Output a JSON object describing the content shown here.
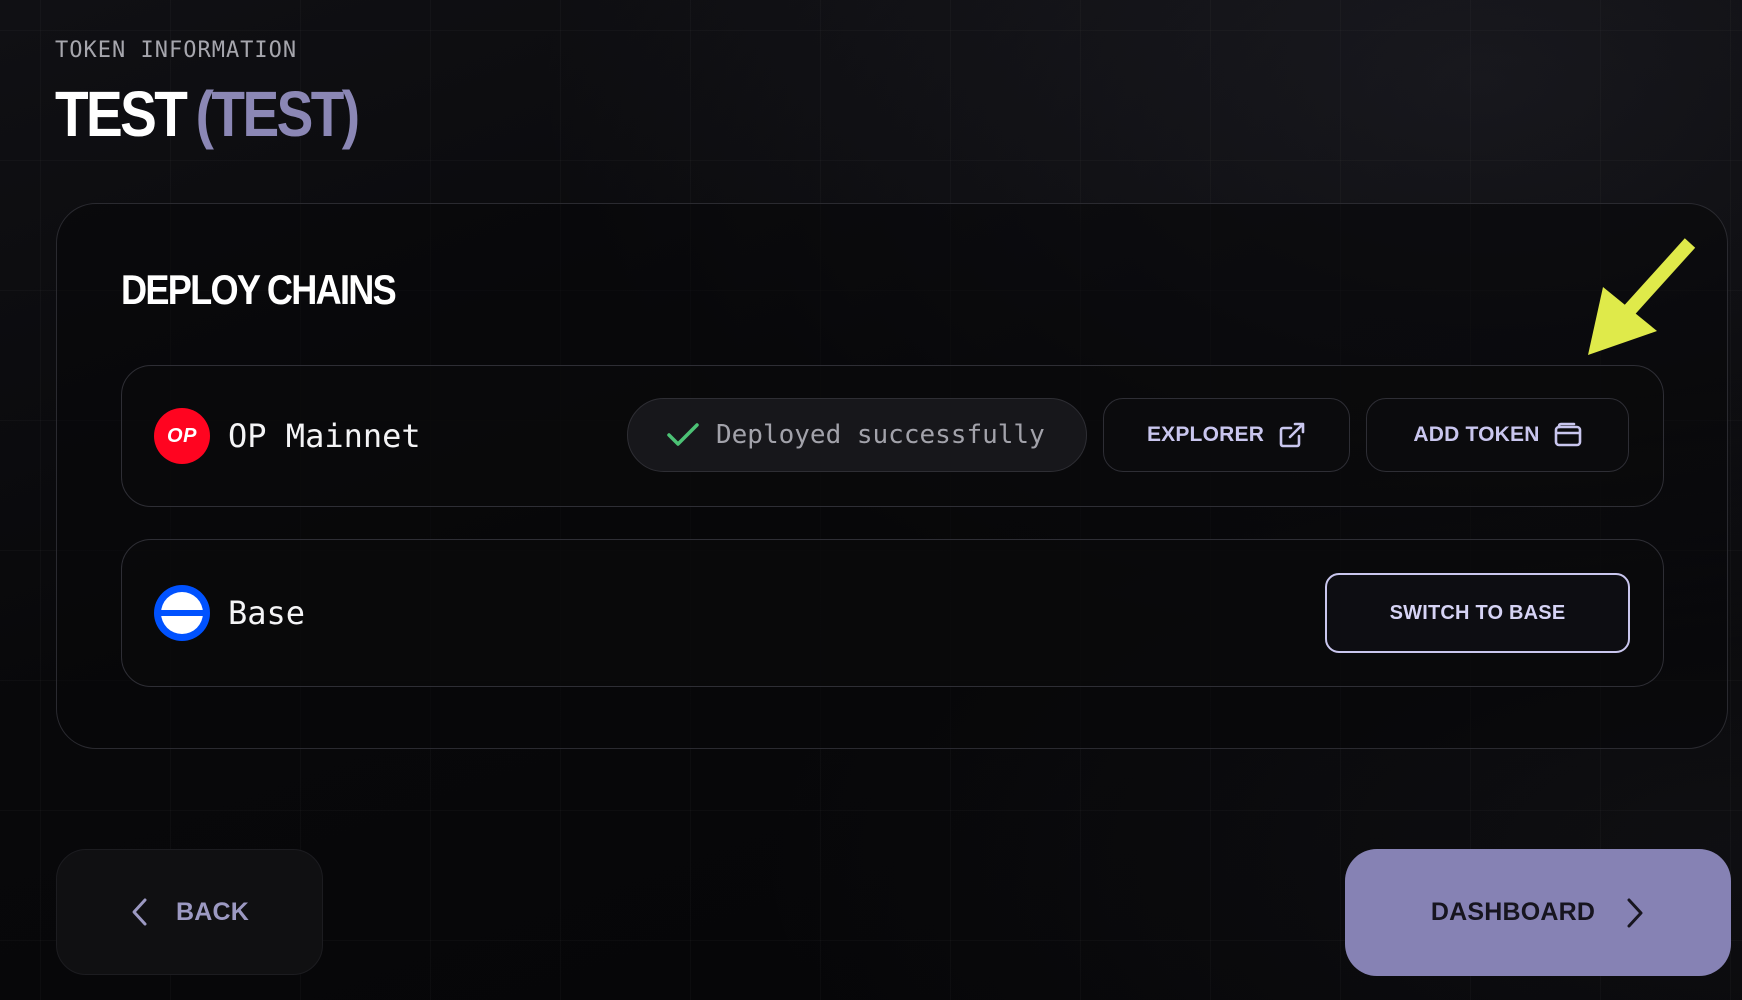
{
  "header": {
    "eyebrow": "TOKEN INFORMATION",
    "token_name": "TEST",
    "token_symbol": "(TEST)"
  },
  "deploy_panel": {
    "title": "DEPLOY CHAINS",
    "chains": [
      {
        "name": "OP Mainnet",
        "logo_text": "OP",
        "logo_color": "#ff0420",
        "status": "Deployed successfully",
        "status_icon": "check-icon",
        "status_color": "#4cc275",
        "actions": [
          {
            "label": "EXPLORER",
            "icon": "external-link-icon"
          },
          {
            "label": "ADD TOKEN",
            "icon": "wallet-icon"
          }
        ]
      },
      {
        "name": "Base",
        "logo_color": "#0052ff",
        "actions": [
          {
            "label": "SWITCH TO BASE"
          }
        ]
      }
    ]
  },
  "footer": {
    "back_label": "BACK",
    "back_icon": "chevron-left-icon",
    "next_label": "DASHBOARD",
    "next_icon": "chevron-right-icon"
  },
  "annotation": {
    "arrow_color": "#dfea4a"
  }
}
